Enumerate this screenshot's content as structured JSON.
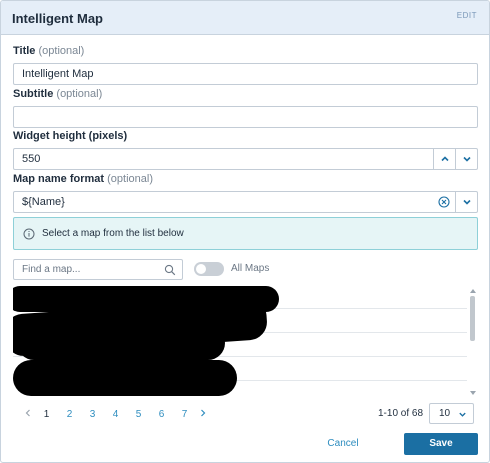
{
  "header": {
    "title": "Intelligent Map",
    "edit_label": "EDIT"
  },
  "form": {
    "title": {
      "label": "Title",
      "optional": "(optional)",
      "value": "Intelligent Map"
    },
    "subtitle": {
      "label": "Subtitle",
      "optional": "(optional)",
      "value": ""
    },
    "widget_height": {
      "label": "Widget height (pixels)",
      "value": "550"
    },
    "map_name_format": {
      "label": "Map name format",
      "optional": "(optional)",
      "value": "${Name}"
    }
  },
  "info": {
    "text": "Select a map from the list below"
  },
  "map_list": {
    "search_placeholder": "Find a map...",
    "toggle_label": "All Maps",
    "toggle_on": false
  },
  "pagination": {
    "pages": [
      "1",
      "2",
      "3",
      "4",
      "5",
      "6",
      "7"
    ],
    "current": "1",
    "range_text": "1-10 of 68",
    "page_size": "10"
  },
  "footer": {
    "cancel_label": "Cancel",
    "save_label": "Save"
  },
  "colors": {
    "accent": "#1b6fa3",
    "link": "#2e8dbf",
    "info_bg": "#e6f5f6",
    "header_bg": "#e5eef8"
  }
}
